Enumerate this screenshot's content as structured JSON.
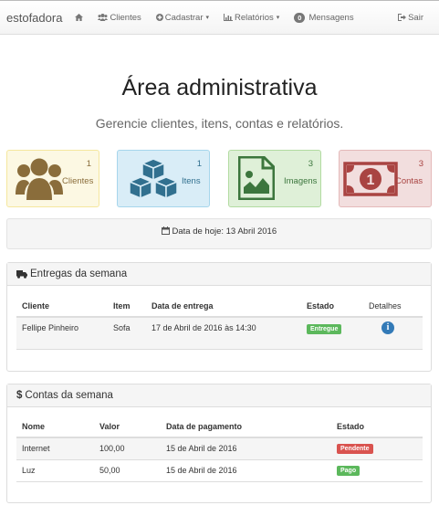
{
  "navbar": {
    "brand": "estofadora",
    "home_icon": "home-icon",
    "items": [
      {
        "label": "Clientes",
        "icon": "users-icon"
      },
      {
        "label": "Cadastrar",
        "icon": "plus-circle-icon"
      },
      {
        "label": "Relatórios",
        "icon": "bar-chart-icon"
      }
    ],
    "messages": {
      "count": "0",
      "label": "Mensagens"
    },
    "logout": {
      "label": "Sair",
      "icon": "sign-out-icon"
    }
  },
  "hero": {
    "title": "Área administrativa",
    "subtitle": "Gerencie clientes, itens, contas e relatórios."
  },
  "tiles": [
    {
      "count": "1",
      "label": "Clientes",
      "icon": "users-icon",
      "color": "#8a6d3b"
    },
    {
      "count": "1",
      "label": "Itens",
      "icon": "cubes-icon",
      "color": "#31708f"
    },
    {
      "count": "3",
      "label": "Imagens",
      "icon": "image-file-icon",
      "color": "#3c763d"
    },
    {
      "count": "3",
      "label": "Contas",
      "icon": "money-icon",
      "color": "#a94442"
    }
  ],
  "date_well": {
    "text": "Data de hoje: 13 Abril 2016",
    "icon": "calendar-icon"
  },
  "deliveries": {
    "title": "Entregas da semana",
    "icon": "truck-icon",
    "columns": [
      "Cliente",
      "Item",
      "Data de entrega",
      "Estado",
      "Detalhes"
    ],
    "rows": [
      {
        "cliente": "Fellipe Pinheiro",
        "item": "Sofa",
        "data": "17 de Abril de 2016 às 14:30",
        "estado": "Entregue",
        "estado_color": "#5cb85c"
      }
    ]
  },
  "accounts": {
    "title": "Contas da semana",
    "icon": "dollar-icon",
    "columns": [
      "Nome",
      "Valor",
      "Data de pagamento",
      "Estado"
    ],
    "rows": [
      {
        "nome": "Internet",
        "valor": "100,00",
        "data": "15 de Abril de 2016",
        "estado": "Pendente",
        "estado_color": "#d9534f"
      },
      {
        "nome": "Luz",
        "valor": "50,00",
        "data": "15 de Abril de 2016",
        "estado": "Pago",
        "estado_color": "#5cb85c"
      }
    ]
  }
}
